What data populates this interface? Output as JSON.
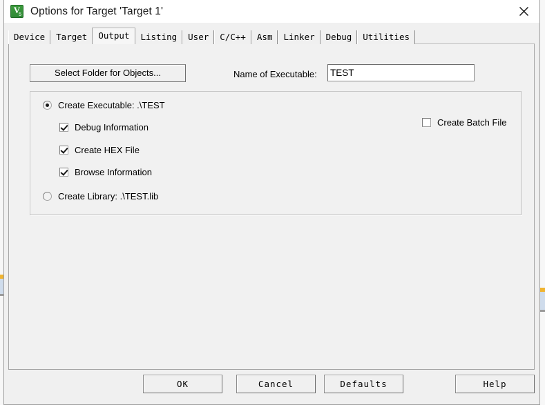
{
  "window": {
    "title": "Options for Target 'Target 1'",
    "icon": "keil-uvision-icon",
    "close_label": "✕"
  },
  "tabs": [
    {
      "label": "Device",
      "selected": false
    },
    {
      "label": "Target",
      "selected": false
    },
    {
      "label": "Output",
      "selected": true
    },
    {
      "label": "Listing",
      "selected": false
    },
    {
      "label": "User",
      "selected": false
    },
    {
      "label": "C/C++",
      "selected": false
    },
    {
      "label": "Asm",
      "selected": false
    },
    {
      "label": "Linker",
      "selected": false
    },
    {
      "label": "Debug",
      "selected": false
    },
    {
      "label": "Utilities",
      "selected": false
    }
  ],
  "output_tab": {
    "select_folder_button": "Select Folder for Objects...",
    "executable_name_label": "Name of Executable:",
    "executable_name_value": "TEST",
    "executable_name_placeholder": "",
    "options": {
      "create_executable": {
        "label": "Create Executable:  .\\TEST",
        "checked": true
      },
      "debug_information": {
        "label": "Debug Information",
        "checked": true
      },
      "create_hex_file": {
        "label": "Create HEX File",
        "checked": true
      },
      "browse_information": {
        "label": "Browse Information",
        "checked": true
      },
      "create_library": {
        "label": "Create Library:  .\\TEST.lib",
        "checked": false
      },
      "create_batch_file": {
        "label": "Create Batch File",
        "checked": false
      }
    }
  },
  "buttons": {
    "ok": "OK",
    "cancel": "Cancel",
    "defaults": "Defaults",
    "help": "Help"
  },
  "colors": {
    "dialog_face": "#f0f0f0",
    "panel_face": "#f1f1f1",
    "title_bar": "#ffffff",
    "icon_green": "#2f8a36",
    "accent_orange": "#f0b431",
    "accent_blue": "#cfdcec"
  }
}
